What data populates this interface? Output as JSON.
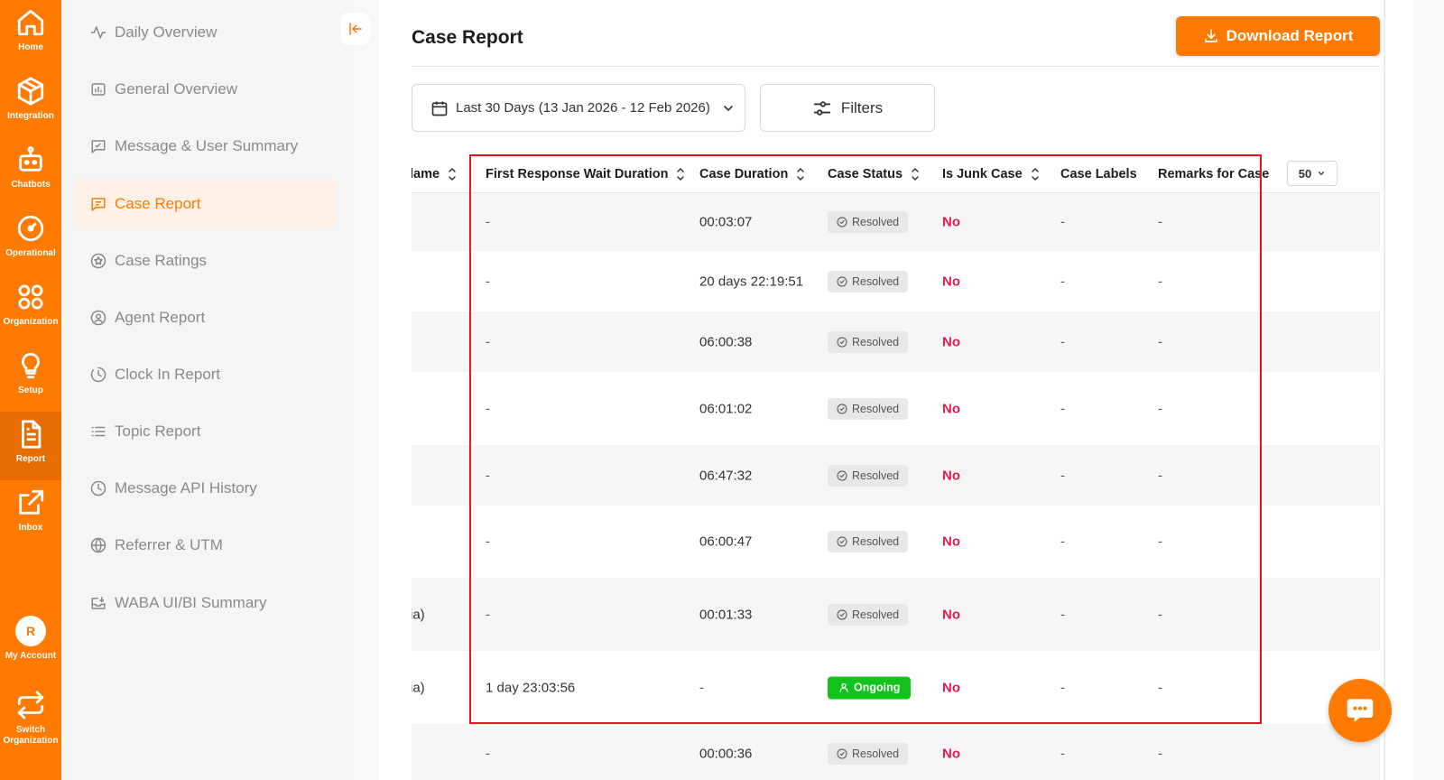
{
  "rail": {
    "items": [
      {
        "label": "Home",
        "icon": "home-icon"
      },
      {
        "label": "Integration",
        "icon": "cube-icon"
      },
      {
        "label": "Chatbots",
        "icon": "robot-icon"
      },
      {
        "label": "Operational",
        "icon": "gauge-icon"
      },
      {
        "label": "Organization",
        "icon": "grid-circles-icon"
      },
      {
        "label": "Setup",
        "icon": "lightbulb-icon"
      },
      {
        "label": "Report",
        "icon": "document-icon"
      },
      {
        "label": "Inbox",
        "icon": "external-link-icon"
      }
    ],
    "account": {
      "avatar_letter": "R",
      "label": "My Account"
    },
    "switch": {
      "label": "Switch Organization"
    }
  },
  "subnav": {
    "items": [
      {
        "label": "Daily Overview",
        "icon": "activity-icon"
      },
      {
        "label": "General Overview",
        "icon": "bar-chart-icon"
      },
      {
        "label": "Message & User Summary",
        "icon": "message-square-icon"
      },
      {
        "label": "Case Report",
        "icon": "case-report-icon"
      },
      {
        "label": "Case Ratings",
        "icon": "star-icon"
      },
      {
        "label": "Agent Report",
        "icon": "user-circle-icon"
      },
      {
        "label": "Clock In Report",
        "icon": "timer-icon"
      },
      {
        "label": "Topic Report",
        "icon": "list-icon"
      },
      {
        "label": "Message API History",
        "icon": "clock-icon"
      },
      {
        "label": "Referrer & UTM",
        "icon": "globe-icon"
      },
      {
        "label": "WABA UI/BI Summary",
        "icon": "inbox-icon"
      }
    ],
    "active_index": 3
  },
  "header": {
    "title": "Case Report",
    "download_label": "Download Report"
  },
  "toolbar": {
    "date_range": "Last 30 Days (13 Jan 2026 - 12 Feb 2026)",
    "filters_label": "Filters"
  },
  "table": {
    "columns": [
      "lame",
      "First Response Wait Duration",
      "Case Duration",
      "Case Status",
      "Is Junk Case",
      "Case Labels",
      "Remarks for Case"
    ],
    "per_page": "50",
    "rows": [
      {
        "name": "",
        "first_response": "-",
        "duration": "00:03:07",
        "status": "Resolved",
        "junk": "No",
        "labels": "-",
        "remarks": "-"
      },
      {
        "name": "",
        "first_response": "-",
        "duration": "20 days 22:19:51",
        "status": "Resolved",
        "junk": "No",
        "labels": "-",
        "remarks": "-"
      },
      {
        "name": "",
        "first_response": "-",
        "duration": "06:00:38",
        "status": "Resolved",
        "junk": "No",
        "labels": "-",
        "remarks": "-"
      },
      {
        "name": "",
        "first_response": "-",
        "duration": "06:01:02",
        "status": "Resolved",
        "junk": "No",
        "labels": "-",
        "remarks": "-"
      },
      {
        "name": "",
        "first_response": "-",
        "duration": "06:47:32",
        "status": "Resolved",
        "junk": "No",
        "labels": "-",
        "remarks": "-"
      },
      {
        "name": "",
        "first_response": "-",
        "duration": "06:00:47",
        "status": "Resolved",
        "junk": "No",
        "labels": "-",
        "remarks": "-"
      },
      {
        "name": "ia)",
        "first_response": "-",
        "duration": "00:01:33",
        "status": "Resolved",
        "junk": "No",
        "labels": "-",
        "remarks": "-"
      },
      {
        "name": "ia)",
        "first_response": "1 day 23:03:56",
        "duration": "-",
        "status": "Ongoing",
        "junk": "No",
        "labels": "-",
        "remarks": "-"
      },
      {
        "name": "",
        "first_response": "-",
        "duration": "00:00:36",
        "status": "Resolved",
        "junk": "No",
        "labels": "-",
        "remarks": "-"
      }
    ]
  },
  "colors": {
    "brand": "#ff7a00",
    "junk_no": "#e8194c",
    "ongoing": "#14c21e",
    "highlight": "#e0181e"
  }
}
